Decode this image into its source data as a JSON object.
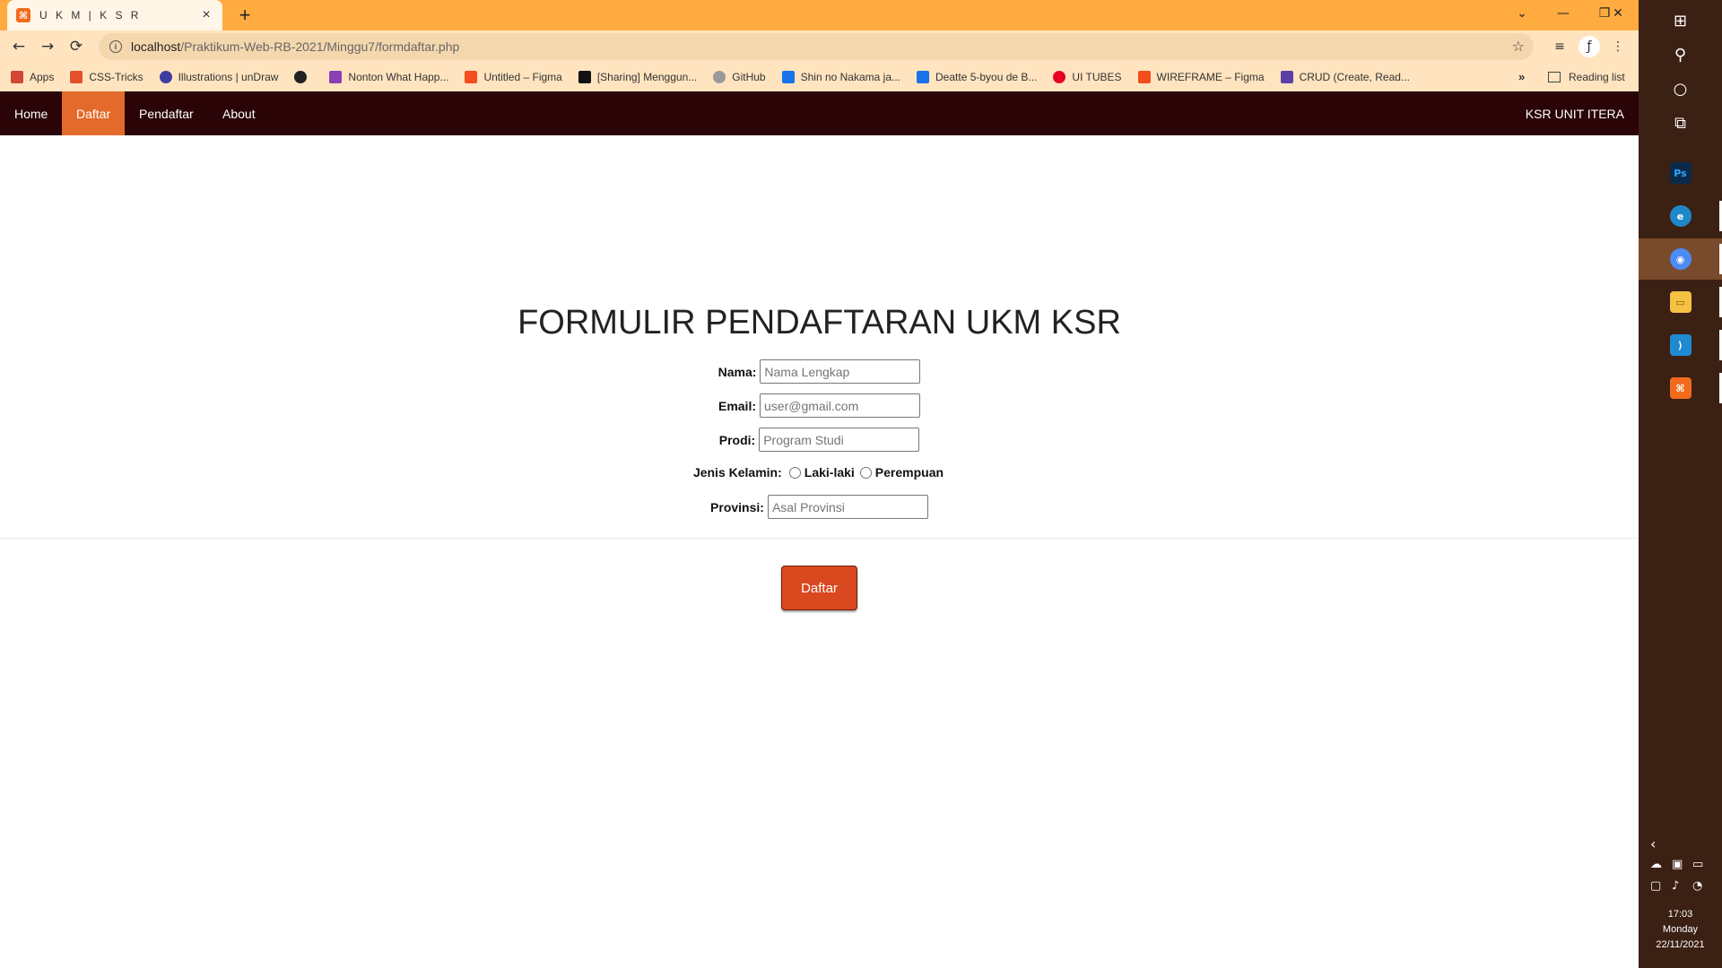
{
  "browser": {
    "tab": {
      "title": "U K M | K S R",
      "favicon_text": "⌘"
    },
    "new_tab_label": "+",
    "window_controls": {
      "list": "⌄",
      "minimize": "—",
      "restore": "❐",
      "close": "✕"
    },
    "nav": {
      "back": "←",
      "forward": "→",
      "reload": "⟳"
    },
    "address": {
      "host": "localhost",
      "path": "/Praktikum-Web-RB-2021/Minggu7/formdaftar.php"
    },
    "bookmarks": [
      {
        "label": "Apps",
        "color": "#d14836"
      },
      {
        "label": "CSS-Tricks",
        "color": "#e4502a"
      },
      {
        "label": "Illustrations | unDraw",
        "color": "#3d3da1"
      },
      {
        "label": "",
        "color": "#222222"
      },
      {
        "label": "Nonton What Happ...",
        "color": "#8a3fb3"
      },
      {
        "label": "Untitled – Figma",
        "color": "#f24e1e"
      },
      {
        "label": "[Sharing] Menggun...",
        "color": "#111111"
      },
      {
        "label": "GitHub",
        "color": "#999999"
      },
      {
        "label": "Shin no Nakama ja...",
        "color": "#1a73e8"
      },
      {
        "label": "Deatte 5-byou de B...",
        "color": "#1a73e8"
      },
      {
        "label": "UI TUBES",
        "color": "#e60023"
      },
      {
        "label": "WIREFRAME – Figma",
        "color": "#f24e1e"
      },
      {
        "label": "CRUD (Create, Read...",
        "color": "#5b3fa8"
      }
    ],
    "bookmarks_more": "»",
    "reading_list": "Reading list"
  },
  "navbar": {
    "links": [
      "Home",
      "Daftar",
      "Pendaftar",
      "About"
    ],
    "active": "Daftar",
    "brand": "KSR UNIT ITERA",
    "bg_color": "#2a0406",
    "active_color": "#e36a2a"
  },
  "form": {
    "title": "FORMULIR PENDAFTARAN UKM KSR",
    "nama": {
      "label": "Nama:",
      "placeholder": "Nama Lengkap"
    },
    "email": {
      "label": "Email:",
      "placeholder": "user@gmail.com"
    },
    "prodi": {
      "label": "Prodi:",
      "placeholder": "Program Studi"
    },
    "gender": {
      "label": "Jenis Kelamin:",
      "options": [
        "Laki-laki",
        "Perempuan"
      ]
    },
    "provinsi": {
      "label": "Provinsi:",
      "placeholder": "Asal Provinsi"
    },
    "submit": "Daftar",
    "submit_color": "#d9481f"
  },
  "taskbar": {
    "start": "⊞",
    "search": "⚲",
    "cortana": "○",
    "taskview": "⧉",
    "apps": [
      {
        "name": "photoshop",
        "text": "Ps",
        "color": "#0b2a4a"
      },
      {
        "name": "edge",
        "text": "e",
        "color": "#1e88c8"
      },
      {
        "name": "chrome",
        "text": "◉",
        "color": "#4c8bf5"
      },
      {
        "name": "file-explorer",
        "text": "▭",
        "color": "#f5c242"
      },
      {
        "name": "vscode",
        "text": "⟩",
        "color": "#1f8ad2"
      },
      {
        "name": "xampp",
        "text": "⌘",
        "color": "#f26b1d"
      }
    ],
    "clock": {
      "time": "17:03",
      "day": "Monday",
      "date": "22/11/2021"
    }
  }
}
